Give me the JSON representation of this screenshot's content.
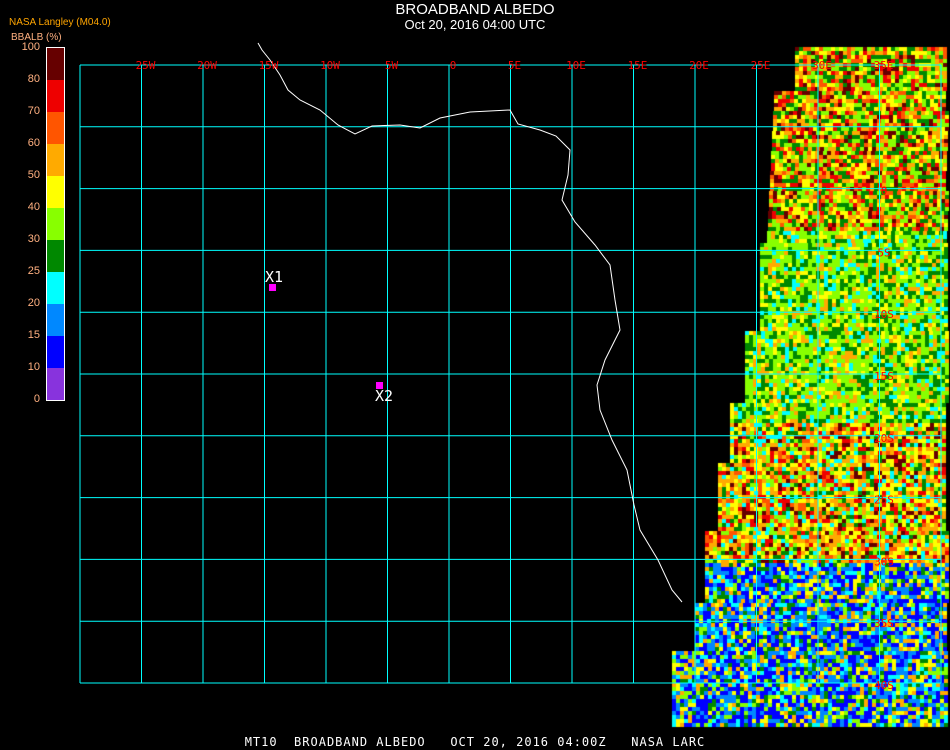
{
  "header": {
    "title": "BROADBAND ALBEDO",
    "datetime": "Oct 20, 2016 04:00 UTC",
    "organization": "NASA Langley (M04.0)"
  },
  "legend": {
    "unit_label": "BBALB (%)",
    "ticks": [
      "100",
      "80",
      "70",
      "60",
      "50",
      "40",
      "30",
      "25",
      "20",
      "15",
      "10",
      "0"
    ],
    "colors": [
      "#660000",
      "#ee0000",
      "#ff5500",
      "#ffaa00",
      "#ffff00",
      "#88ff00",
      "#008800",
      "#00ffff",
      "#0088ff",
      "#0000ff",
      "#8833dd"
    ]
  },
  "map": {
    "lon_labels": [
      "25W",
      "20W",
      "15W",
      "10W",
      "5W",
      "0",
      "5E",
      "10E",
      "15E",
      "20E",
      "25E",
      "30E",
      "35E"
    ],
    "lat_labels": [
      "0",
      "5S",
      "10S",
      "15S",
      "20S",
      "25S",
      "30S",
      "35S",
      "40S"
    ],
    "markers": [
      {
        "label": "X1"
      },
      {
        "label": "X2"
      }
    ],
    "grid_color": "#00ffff",
    "label_color": "#ff0000",
    "marker_color": "#ff00ff"
  },
  "footer": {
    "text": "MT10  BROADBAND ALBEDO   OCT 20, 2016 04:00Z   NASA LARC"
  }
}
